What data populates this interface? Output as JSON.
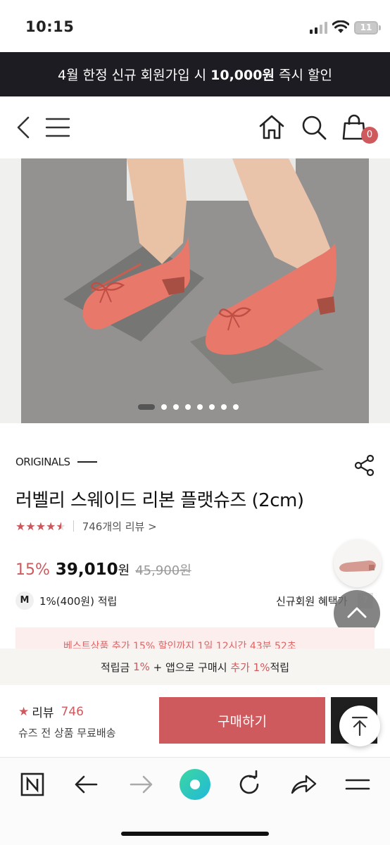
{
  "status_bar": {
    "time": "10:15",
    "battery": "11"
  },
  "promo": {
    "pre": "4월 한정 신규 회원가입 시 ",
    "amount": "10,000원",
    "post": " 즉시 할인"
  },
  "header": {
    "cart_count": "0",
    "icons": [
      "back-icon",
      "menu-icon",
      "home-icon",
      "search-icon",
      "cart-icon"
    ]
  },
  "gallery": {
    "slide_count": 8,
    "active_index": 0
  },
  "product": {
    "brand": "ORIGINALS",
    "title": "러벨리 스웨이드 리본 플랫슈즈 (2cm)",
    "rating": 4.5,
    "stars": "★★★★★",
    "review_link": "746개의 리뷰 >",
    "discount": "15%",
    "price": "39,010",
    "currency": "원",
    "original_price": "45,900원",
    "member_grade": "M",
    "points": "1%(400원) 적립",
    "member_benefit": "신규회원 혜택가",
    "help": "?"
  },
  "best_strip": "베스트상품 추가 15% 할인까지 1일 12시간 43분 52초",
  "accum": {
    "pre": "적립금 ",
    "pct": "1%",
    "mid": " + 앱으로 구매시 ",
    "extra": "추가 1%",
    "post": "적립"
  },
  "buybar": {
    "review_label": "리뷰",
    "review_count": "746",
    "shipping": "슈즈 전 상품 무료배송",
    "buy_label": "구매하기"
  },
  "colors": {
    "accent": "#cf5a5e",
    "banner": "#1c1c22",
    "shoe": "#e8796a"
  }
}
